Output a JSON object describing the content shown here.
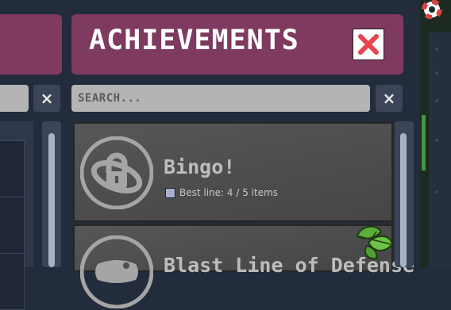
{
  "header": {
    "title": "ACHIEVEMENTS"
  },
  "search": {
    "placeholder": "SEARCH...",
    "clear_label": "×"
  },
  "left_panel": {
    "clear_label": "×"
  },
  "achievements": [
    {
      "name": "Bingo!",
      "progress": "Best line: 4 / 5 items",
      "icon": "orbit-lock-icon"
    },
    {
      "name": "Blast Line of Defense",
      "icon": "gamepad-icon"
    }
  ],
  "icons": {
    "close": "close-icon",
    "leaf": "leaf-badge-icon",
    "lifebuoy": "lifebuoy-icon"
  },
  "colors": {
    "header_bg": "#7e3a5f",
    "close_x": "#e8434f",
    "card_bg": "#555555",
    "scrollbar_thumb": "#a8b0c4"
  }
}
